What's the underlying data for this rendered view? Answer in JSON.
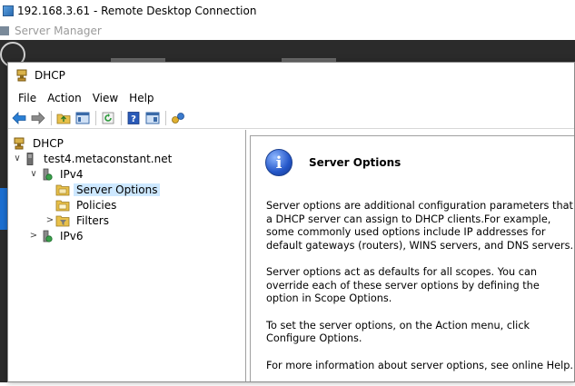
{
  "rdc": {
    "title": "192.168.3.61 - Remote Desktop Connection"
  },
  "server_manager": {
    "title": "Server Manager"
  },
  "window": {
    "title": "DHCP"
  },
  "menu": [
    "File",
    "Action",
    "View",
    "Help"
  ],
  "toolbar": {
    "buttons": [
      "back-arrow-icon",
      "forward-arrow-icon",
      "up-folder-icon",
      "show-hide-tree-icon",
      "refresh-icon",
      "help-icon",
      "properties-icon",
      "dhcp-action-icon"
    ]
  },
  "tree": {
    "root": "DHCP",
    "server": "test4.metaconstant.net",
    "ipv4": "IPv4",
    "server_options": "Server Options",
    "policies": "Policies",
    "filters": "Filters",
    "ipv6": "IPv6"
  },
  "detail": {
    "title": "Server Options",
    "paragraphs": [
      "Server options are additional configuration parameters that a DHCP server can assign to DHCP clients.For example, some commonly used options include IP addresses for default gateways (routers), WINS servers, and DNS servers.",
      "Server options act as defaults for all scopes.  You can override each of these server options by defining the option in Scope Options.",
      "To set the server options, on the Action menu, click Configure Options.",
      "For more information about server options, see online Help."
    ]
  },
  "colors": {
    "selection": "#cde8ff",
    "info_blue": "#2456c8",
    "dark_bg": "#2b2b2b"
  }
}
